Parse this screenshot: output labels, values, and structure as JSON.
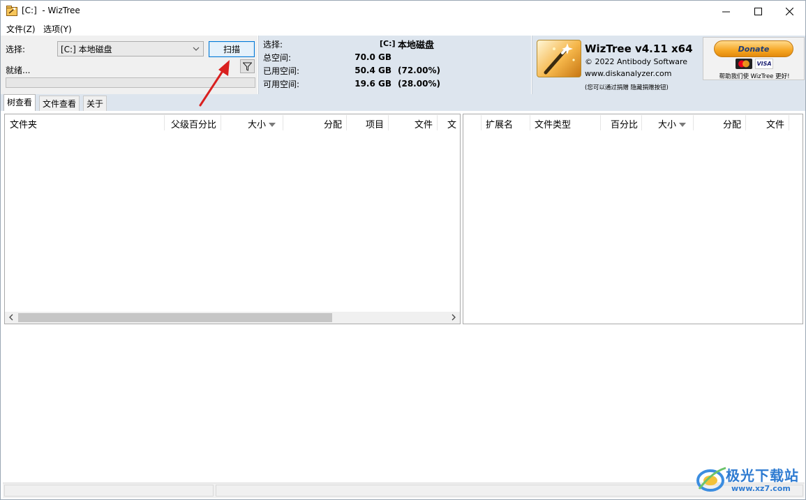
{
  "window": {
    "title": "[C:]  - WizTree",
    "controls": [
      "minimize",
      "maximize",
      "close"
    ]
  },
  "menu": {
    "file": "文件(Z)",
    "options": "选项(Y)"
  },
  "scan": {
    "select_label": "选择:",
    "drive_value": "[C:] 本地磁盘",
    "scan_button": "扫描",
    "status": "就绪...",
    "progress": 0
  },
  "info": {
    "selected_label": "选择:",
    "selected_drive": "[C:]",
    "selected_name": "本地磁盘",
    "total_label": "总空间:",
    "total_value": "70.0 GB",
    "used_label": "已用空间:",
    "used_value": "50.4 GB",
    "used_pct": "(72.00%)",
    "free_label": "可用空间:",
    "free_value": "19.6 GB",
    "free_pct": "(28.00%)"
  },
  "brand": {
    "title": "WizTree v4.11 x64",
    "copyright": "© 2022 Antibody Software",
    "url": "www.diskanalyzer.com",
    "note": "(您可以通过捐赠 隐藏捐赠按钮)",
    "donate_label": "Donate",
    "card_visa": "VISA",
    "donate_note": "帮助我们使 WizTree 更好!"
  },
  "tabs": [
    {
      "label": "树查看"
    },
    {
      "label": "文件查看"
    },
    {
      "label": "关于"
    }
  ],
  "tree_table": {
    "columns": [
      "文件夹",
      "父级百分比",
      "大小",
      "分配",
      "项目",
      "文件",
      "文"
    ]
  },
  "ext_table": {
    "columns": [
      "扩展名",
      "文件类型",
      "百分比",
      "大小",
      "分配",
      "文件"
    ]
  },
  "watermark": {
    "name": "极光下载站",
    "url": "www.xz7.com"
  },
  "colors": {
    "panel_bg": "#dde5ee",
    "scan_button_border": "#0078d7",
    "arrow": "#d9201f",
    "watermark": "#2e7bd1"
  }
}
